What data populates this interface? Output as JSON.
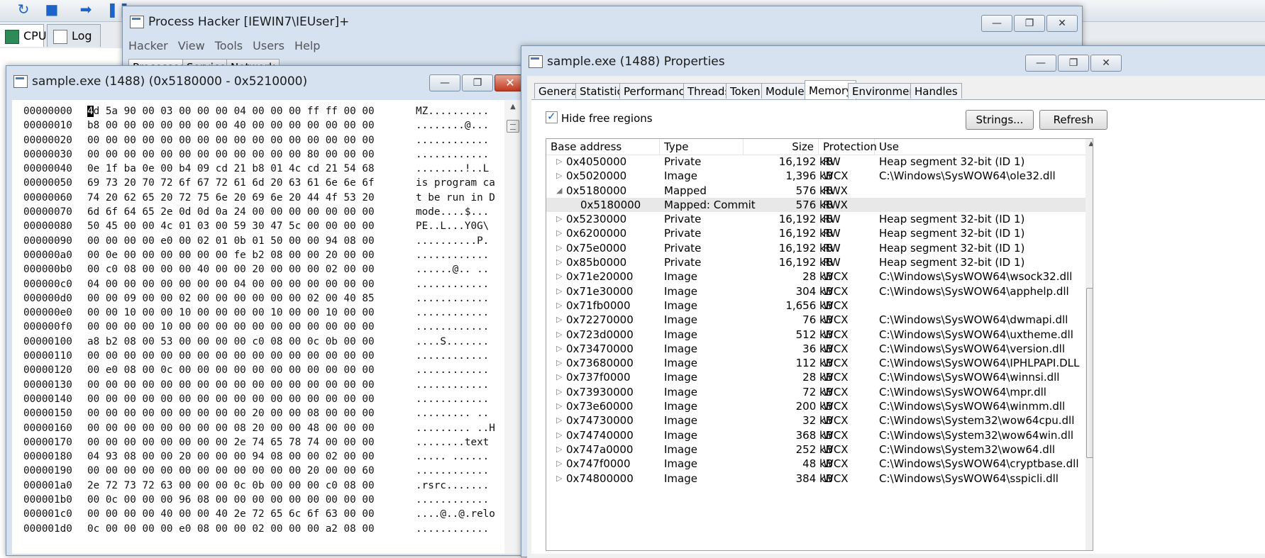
{
  "background_app": {
    "tabs": [
      {
        "label": "CPU"
      },
      {
        "label": "Log"
      }
    ]
  },
  "process_hacker": {
    "title": "Process Hacker [IEWIN7\\IEUser]+",
    "menu": [
      "Hacker",
      "View",
      "Tools",
      "Users",
      "Help"
    ],
    "tabs": [
      "Processes",
      "Services",
      "Network"
    ]
  },
  "hex_window": {
    "title": "sample.exe (1488) (0x5180000 - 0x5210000)",
    "lines": [
      {
        "addr": "00000000",
        "bytes": "4d 5a 90 00 03 00 00 00 04 00 00 00 ff ff 00 00",
        "ascii": "MZ.........."
      },
      {
        "addr": "00000010",
        "bytes": "b8 00 00 00 00 00 00 00 40 00 00 00 00 00 00 00",
        "ascii": "........@..."
      },
      {
        "addr": "00000020",
        "bytes": "00 00 00 00 00 00 00 00 00 00 00 00 00 00 00 00",
        "ascii": "............"
      },
      {
        "addr": "00000030",
        "bytes": "00 00 00 00 00 00 00 00 00 00 00 00 80 00 00 00",
        "ascii": "............"
      },
      {
        "addr": "00000040",
        "bytes": "0e 1f ba 0e 00 b4 09 cd 21 b8 01 4c cd 21 54 68",
        "ascii": "........!..L"
      },
      {
        "addr": "00000050",
        "bytes": "69 73 20 70 72 6f 67 72 61 6d 20 63 61 6e 6e 6f",
        "ascii": "is program ca"
      },
      {
        "addr": "00000060",
        "bytes": "74 20 62 65 20 72 75 6e 20 69 6e 20 44 4f 53 20",
        "ascii": "t be run in D"
      },
      {
        "addr": "00000070",
        "bytes": "6d 6f 64 65 2e 0d 0d 0a 24 00 00 00 00 00 00 00",
        "ascii": "mode....$..."
      },
      {
        "addr": "00000080",
        "bytes": "50 45 00 00 4c 01 03 00 59 30 47 5c 00 00 00 00",
        "ascii": "PE..L...Y0G\\"
      },
      {
        "addr": "00000090",
        "bytes": "00 00 00 00 e0 00 02 01 0b 01 50 00 00 94 08 00",
        "ascii": "..........P."
      },
      {
        "addr": "000000a0",
        "bytes": "00 0e 00 00 00 00 00 00 fe b2 08 00 00 20 00 00",
        "ascii": "............"
      },
      {
        "addr": "000000b0",
        "bytes": "00 c0 08 00 00 00 40 00 00 20 00 00 00 02 00 00",
        "ascii": "......@.. .."
      },
      {
        "addr": "000000c0",
        "bytes": "04 00 00 00 00 00 00 00 04 00 00 00 00 00 00 00",
        "ascii": "............"
      },
      {
        "addr": "000000d0",
        "bytes": "00 00 09 00 00 02 00 00 00 00 00 00 02 00 40 85",
        "ascii": "............"
      },
      {
        "addr": "000000e0",
        "bytes": "00 00 10 00 00 10 00 00 00 00 10 00 00 10 00 00",
        "ascii": "............"
      },
      {
        "addr": "000000f0",
        "bytes": "00 00 00 00 10 00 00 00 00 00 00 00 00 00 00 00",
        "ascii": "............"
      },
      {
        "addr": "00000100",
        "bytes": "a8 b2 08 00 53 00 00 00 00 c0 08 00 0c 0b 00 00",
        "ascii": "....S......."
      },
      {
        "addr": "00000110",
        "bytes": "00 00 00 00 00 00 00 00 00 00 00 00 00 00 00 00",
        "ascii": "............"
      },
      {
        "addr": "00000120",
        "bytes": "00 e0 08 00 0c 00 00 00 00 00 00 00 00 00 00 00",
        "ascii": "............"
      },
      {
        "addr": "00000130",
        "bytes": "00 00 00 00 00 00 00 00 00 00 00 00 00 00 00 00",
        "ascii": "............"
      },
      {
        "addr": "00000140",
        "bytes": "00 00 00 00 00 00 00 00 00 00 00 00 00 00 00 00",
        "ascii": "............"
      },
      {
        "addr": "00000150",
        "bytes": "00 00 00 00 00 00 00 00 00 20 00 00 08 00 00 00",
        "ascii": "......... .."
      },
      {
        "addr": "00000160",
        "bytes": "00 00 00 00 00 00 00 00 08 20 00 00 48 00 00 00",
        "ascii": "......... ..H"
      },
      {
        "addr": "00000170",
        "bytes": "00 00 00 00 00 00 00 00 2e 74 65 78 74 00 00 00",
        "ascii": "........text"
      },
      {
        "addr": "00000180",
        "bytes": "04 93 08 00 00 20 00 00 00 94 08 00 00 02 00 00",
        "ascii": "..... ......"
      },
      {
        "addr": "00000190",
        "bytes": "00 00 00 00 00 00 00 00 00 00 00 00 20 00 00 60",
        "ascii": "............"
      },
      {
        "addr": "000001a0",
        "bytes": "2e 72 73 72 63 00 00 00 0c 0b 00 00 00 c0 08 00",
        "ascii": ".rsrc......."
      },
      {
        "addr": "000001b0",
        "bytes": "00 0c 00 00 00 96 08 00 00 00 00 00 00 00 00 00",
        "ascii": "............"
      },
      {
        "addr": "000001c0",
        "bytes": "00 00 00 00 40 00 00 40 2e 72 65 6c 6f 63 00 00",
        "ascii": "....@..@.relo"
      },
      {
        "addr": "000001d0",
        "bytes": "0c 00 00 00 00 e0 08 00 00 02 00 00 00 a2 08 00",
        "ascii": "............"
      }
    ]
  },
  "properties_window": {
    "title": "sample.exe (1488) Properties",
    "tabs": [
      "General",
      "Statistics",
      "Performance",
      "Threads",
      "Token",
      "Modules",
      "Memory",
      "Environment",
      "Handles"
    ],
    "active_tab": "Memory",
    "hide_free_label": "Hide free regions",
    "strings_label": "Strings...",
    "refresh_label": "Refresh",
    "columns": [
      "Base address",
      "Type",
      "Size",
      "Protection",
      "Use"
    ],
    "rows": [
      {
        "exp": "▷",
        "base": "0x4050000",
        "type": "Private",
        "size": "16,192 kB",
        "prot": "RW",
        "use": "Heap segment 32-bit (ID 1)"
      },
      {
        "exp": "▷",
        "base": "0x5020000",
        "type": "Image",
        "size": "1,396 kB",
        "prot": "WCX",
        "use": "C:\\Windows\\SysWOW64\\ole32.dll"
      },
      {
        "exp": "◢",
        "base": "0x5180000",
        "type": "Mapped",
        "size": "576 kB",
        "prot": "RWX",
        "use": ""
      },
      {
        "exp": "",
        "base": "0x5180000",
        "type": "Mapped: Commit",
        "size": "576 kB",
        "prot": "RWX",
        "use": "",
        "child": true,
        "selected": true
      },
      {
        "exp": "▷",
        "base": "0x5230000",
        "type": "Private",
        "size": "16,192 kB",
        "prot": "RW",
        "use": "Heap segment 32-bit (ID 1)"
      },
      {
        "exp": "▷",
        "base": "0x6200000",
        "type": "Private",
        "size": "16,192 kB",
        "prot": "RW",
        "use": "Heap segment 32-bit (ID 1)"
      },
      {
        "exp": "▷",
        "base": "0x75e0000",
        "type": "Private",
        "size": "16,192 kB",
        "prot": "RW",
        "use": "Heap segment 32-bit (ID 1)"
      },
      {
        "exp": "▷",
        "base": "0x85b0000",
        "type": "Private",
        "size": "16,192 kB",
        "prot": "RW",
        "use": "Heap segment 32-bit (ID 1)"
      },
      {
        "exp": "▷",
        "base": "0x71e20000",
        "type": "Image",
        "size": "28 kB",
        "prot": "WCX",
        "use": "C:\\Windows\\SysWOW64\\wsock32.dll"
      },
      {
        "exp": "▷",
        "base": "0x71e30000",
        "type": "Image",
        "size": "304 kB",
        "prot": "WCX",
        "use": "C:\\Windows\\SysWOW64\\apphelp.dll"
      },
      {
        "exp": "▷",
        "base": "0x71fb0000",
        "type": "Image",
        "size": "1,656 kB",
        "prot": "WCX",
        "use": ""
      },
      {
        "exp": "▷",
        "base": "0x72270000",
        "type": "Image",
        "size": "76 kB",
        "prot": "WCX",
        "use": "C:\\Windows\\SysWOW64\\dwmapi.dll"
      },
      {
        "exp": "▷",
        "base": "0x723d0000",
        "type": "Image",
        "size": "512 kB",
        "prot": "WCX",
        "use": "C:\\Windows\\SysWOW64\\uxtheme.dll"
      },
      {
        "exp": "▷",
        "base": "0x73470000",
        "type": "Image",
        "size": "36 kB",
        "prot": "WCX",
        "use": "C:\\Windows\\SysWOW64\\version.dll"
      },
      {
        "exp": "▷",
        "base": "0x73680000",
        "type": "Image",
        "size": "112 kB",
        "prot": "WCX",
        "use": "C:\\Windows\\SysWOW64\\IPHLPAPI.DLL"
      },
      {
        "exp": "▷",
        "base": "0x737f0000",
        "type": "Image",
        "size": "28 kB",
        "prot": "WCX",
        "use": "C:\\Windows\\SysWOW64\\winnsi.dll"
      },
      {
        "exp": "▷",
        "base": "0x73930000",
        "type": "Image",
        "size": "72 kB",
        "prot": "WCX",
        "use": "C:\\Windows\\SysWOW64\\mpr.dll"
      },
      {
        "exp": "▷",
        "base": "0x73e60000",
        "type": "Image",
        "size": "200 kB",
        "prot": "WCX",
        "use": "C:\\Windows\\SysWOW64\\winmm.dll"
      },
      {
        "exp": "▷",
        "base": "0x74730000",
        "type": "Image",
        "size": "32 kB",
        "prot": "WCX",
        "use": "C:\\Windows\\System32\\wow64cpu.dll"
      },
      {
        "exp": "▷",
        "base": "0x74740000",
        "type": "Image",
        "size": "368 kB",
        "prot": "WCX",
        "use": "C:\\Windows\\System32\\wow64win.dll"
      },
      {
        "exp": "▷",
        "base": "0x747a0000",
        "type": "Image",
        "size": "252 kB",
        "prot": "WCX",
        "use": "C:\\Windows\\System32\\wow64.dll"
      },
      {
        "exp": "▷",
        "base": "0x747f0000",
        "type": "Image",
        "size": "48 kB",
        "prot": "WCX",
        "use": "C:\\Windows\\SysWOW64\\cryptbase.dll"
      },
      {
        "exp": "▷",
        "base": "0x74800000",
        "type": "Image",
        "size": "384 kB",
        "prot": "WCX",
        "use": "C:\\Windows\\SysWOW64\\sspicli.dll"
      }
    ]
  }
}
